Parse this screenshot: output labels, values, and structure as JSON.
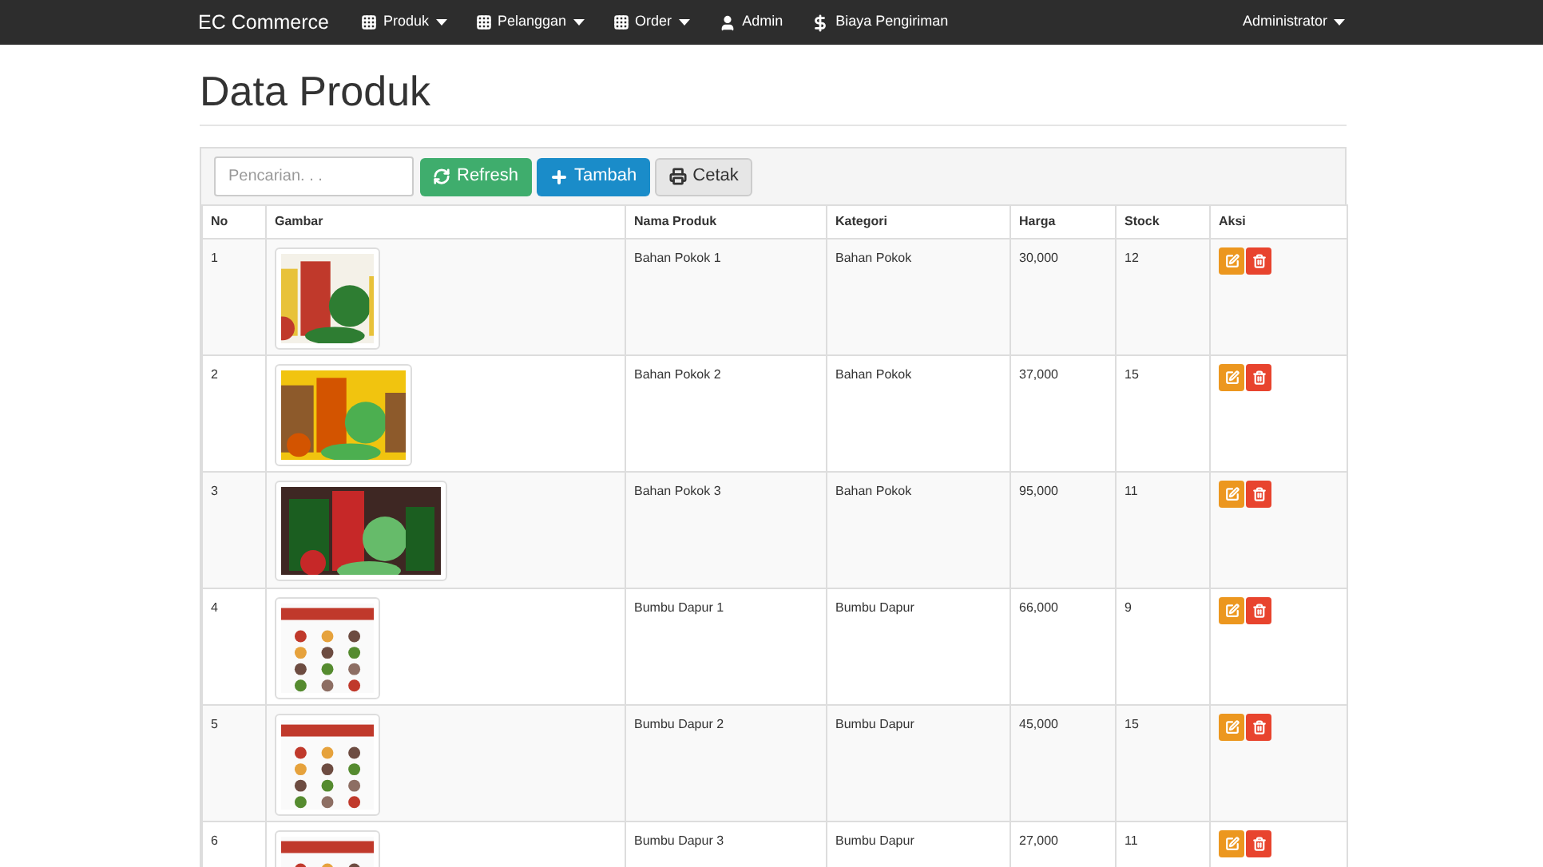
{
  "navbar": {
    "brand": "EC Commerce",
    "items": [
      {
        "label": "Produk",
        "kind": "grid",
        "dropdown": true
      },
      {
        "label": "Pelanggan",
        "kind": "grid",
        "dropdown": true
      },
      {
        "label": "Order",
        "kind": "grid",
        "dropdown": true
      },
      {
        "label": "Admin",
        "kind": "user",
        "dropdown": false
      },
      {
        "label": "Biaya Pengiriman",
        "kind": "dollar",
        "dropdown": false
      }
    ],
    "user_menu": {
      "label": "Administrator",
      "dropdown": true
    }
  },
  "page_title": "Data Produk",
  "toolbar": {
    "search": {
      "placeholder": "Pencarian. . ."
    },
    "buttons": [
      {
        "label": "Refresh",
        "kind": "refresh"
      },
      {
        "label": "Tambah",
        "kind": "add"
      },
      {
        "label": "Cetak",
        "kind": "print"
      }
    ]
  },
  "table": {
    "columns": [
      "No",
      "Gambar",
      "Nama Produk",
      "Kategori",
      "Harga",
      "Stock",
      "Aksi"
    ],
    "rows": [
      {
        "no": "1",
        "name": "Bahan Pokok 1",
        "category": "Bahan Pokok",
        "price": "30,000",
        "stock": "12"
      },
      {
        "no": "2",
        "name": "Bahan Pokok 2",
        "category": "Bahan Pokok",
        "price": "37,000",
        "stock": "15"
      },
      {
        "no": "3",
        "name": "Bahan Pokok 3",
        "category": "Bahan Pokok",
        "price": "95,000",
        "stock": "11"
      },
      {
        "no": "4",
        "name": "Bumbu Dapur 1",
        "category": "Bumbu Dapur",
        "price": "66,000",
        "stock": "9"
      },
      {
        "no": "5",
        "name": "Bumbu Dapur 2",
        "category": "Bumbu Dapur",
        "price": "45,000",
        "stock": "15"
      },
      {
        "no": "6",
        "name": "Bumbu Dapur 3",
        "category": "Bumbu Dapur",
        "price": "27,000",
        "stock": "11"
      }
    ]
  }
}
